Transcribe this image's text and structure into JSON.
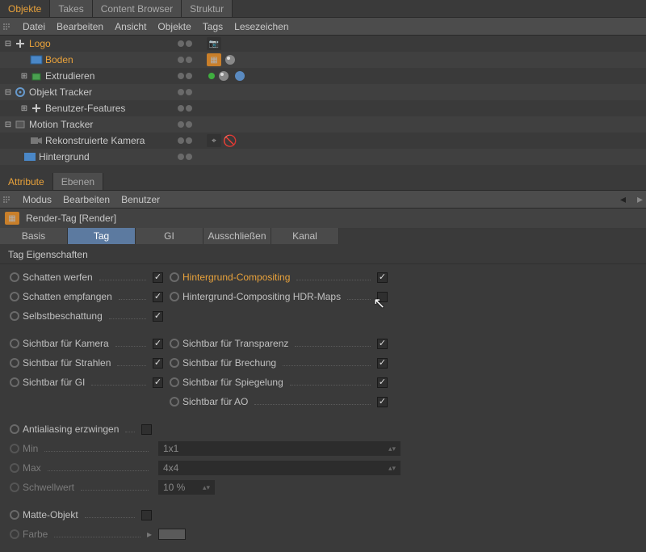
{
  "topTabs": {
    "objects": "Objekte",
    "takes": "Takes",
    "contentBrowser": "Content Browser",
    "structure": "Struktur"
  },
  "objMenu": {
    "file": "Datei",
    "edit": "Bearbeiten",
    "view": "Ansicht",
    "objects": "Objekte",
    "tags": "Tags",
    "bookmarks": "Lesezeichen"
  },
  "tree": {
    "logo": "Logo",
    "boden": "Boden",
    "extrude": "Extrudieren",
    "objTracker": "Objekt Tracker",
    "userFeatures": "Benutzer-Features",
    "motionTracker": "Motion Tracker",
    "reconCam": "Rekonstruierte Kamera",
    "background": "Hintergrund"
  },
  "attrTabs": {
    "attribute": "Attribute",
    "layers": "Ebenen"
  },
  "attrMenu": {
    "mode": "Modus",
    "edit": "Bearbeiten",
    "user": "Benutzer"
  },
  "attrTitle": "Render-Tag [Render]",
  "subtabs": {
    "basis": "Basis",
    "tag": "Tag",
    "gi": "GI",
    "exclude": "Ausschließen",
    "channel": "Kanal"
  },
  "section": "Tag Eigenschaften",
  "props": {
    "castShadow": "Schatten werfen",
    "recvShadow": "Schatten empfangen",
    "selfShadow": "Selbstbeschattung",
    "bgComp": "Hintergrund-Compositing",
    "bgCompHdr": "Hintergrund-Compositing HDR-Maps",
    "visCam": "Sichtbar für Kamera",
    "visRays": "Sichtbar für Strahlen",
    "visGI": "Sichtbar für GI",
    "visTrans": "Sichtbar für Transparenz",
    "visRefr": "Sichtbar für Brechung",
    "visRefl": "Sichtbar für Spiegelung",
    "visAO": "Sichtbar für AO",
    "forceAA": "Antialiasing erzwingen",
    "min": "Min",
    "max": "Max",
    "threshold": "Schwellwert",
    "matte": "Matte-Objekt",
    "color": "Farbe"
  },
  "values": {
    "min": "1x1",
    "max": "4x4",
    "threshold": "10 %"
  }
}
